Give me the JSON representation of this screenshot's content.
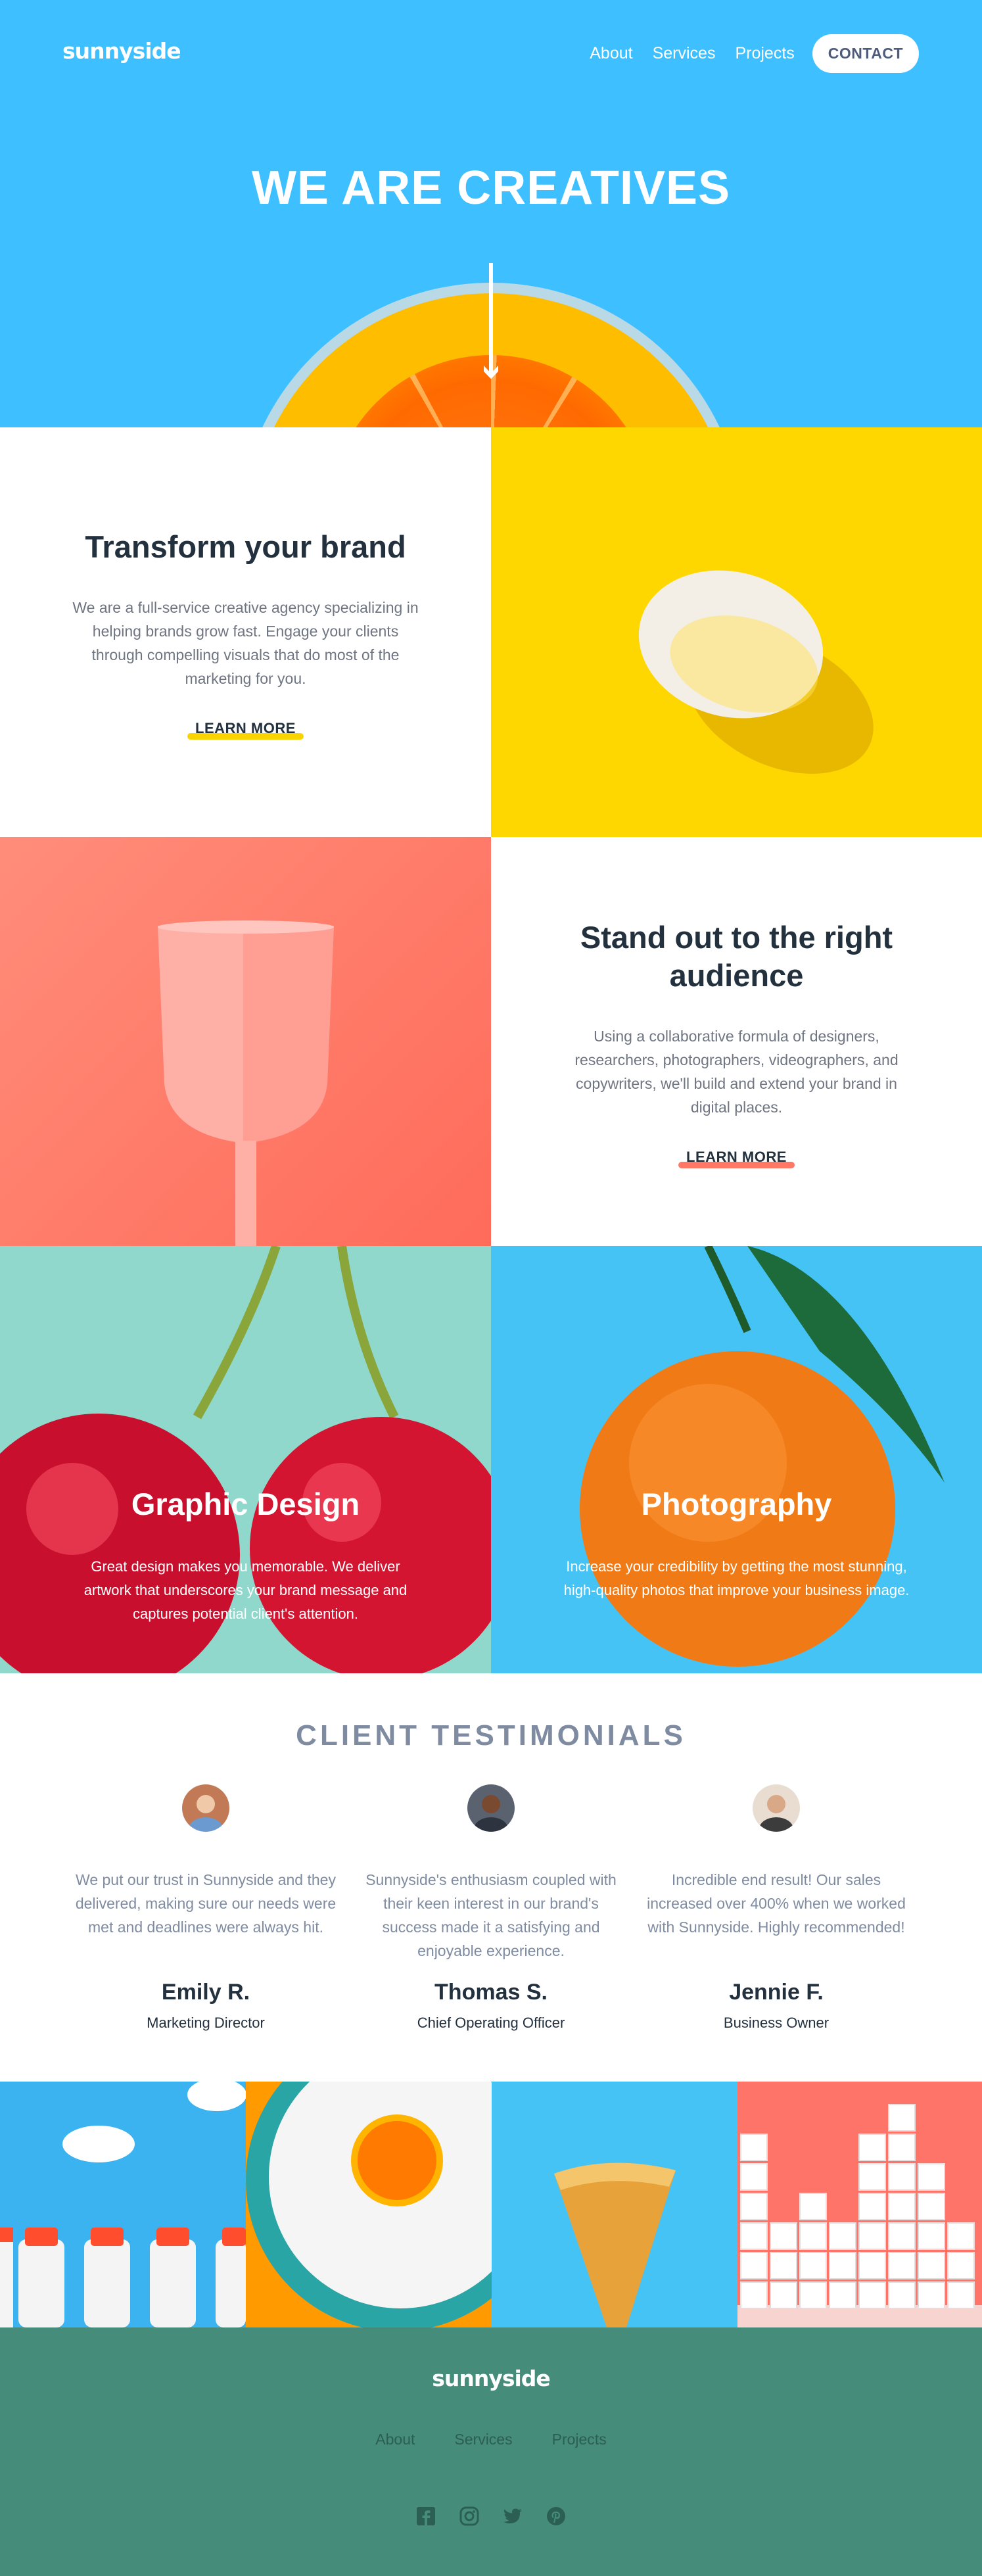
{
  "brand": {
    "logo": "sunnyside"
  },
  "nav": {
    "items": [
      "About",
      "Services",
      "Projects"
    ],
    "contact": "CONTACT"
  },
  "hero": {
    "title": "WE ARE CREATIVES",
    "arrow_icon": "arrow-down-icon"
  },
  "features": [
    {
      "title": "Transform your brand",
      "text": "We are a full-service creative agency specializing in helping brands grow fast. Engage your clients through compelling visuals that do most of the marketing for you.",
      "link": "LEARN MORE",
      "accent": "#fad400"
    },
    {
      "title": "Stand out to the right audience",
      "text": "Using a collaborative formula of designers, researchers, photographers, videographers, and copywriters, we'll build and extend your brand in digital places.",
      "link": "LEARN MORE",
      "accent": "#fe7865"
    }
  ],
  "services": [
    {
      "title": "Graphic Design",
      "text": "Great design makes you memorable. We deliver artwork that underscores your brand message and captures potential client's attention."
    },
    {
      "title": "Photography",
      "text": "Increase your credibility by getting the most stunning, high-quality photos that improve your business image."
    }
  ],
  "testimonials": {
    "heading": "CLIENT TESTIMONIALS",
    "items": [
      {
        "quote": "We put our trust in Sunnyside and they delivered, making sure our needs were met and deadlines were always hit.",
        "name": "Emily R.",
        "role": "Marketing Director"
      },
      {
        "quote": "Sunnyside's enthusiasm coupled with their keen interest in our brand's success made it a satisfying and enjoyable experience.",
        "name": "Thomas S.",
        "role": "Chief Operating Officer"
      },
      {
        "quote": "Incredible end result! Our sales increased over 400% when we worked with Sunnyside. Highly recommended!",
        "name": "Jennie F.",
        "role": "Business Owner"
      }
    ]
  },
  "footer": {
    "logo": "sunnyside",
    "nav": [
      "About",
      "Services",
      "Projects"
    ],
    "social": [
      "facebook-icon",
      "instagram-icon",
      "twitter-icon",
      "pinterest-icon"
    ]
  },
  "colors": {
    "hero_blue": "#3ebfff",
    "footer_green": "#468c7b",
    "heading_dark": "#23303e",
    "text_grey": "#6f7682"
  }
}
